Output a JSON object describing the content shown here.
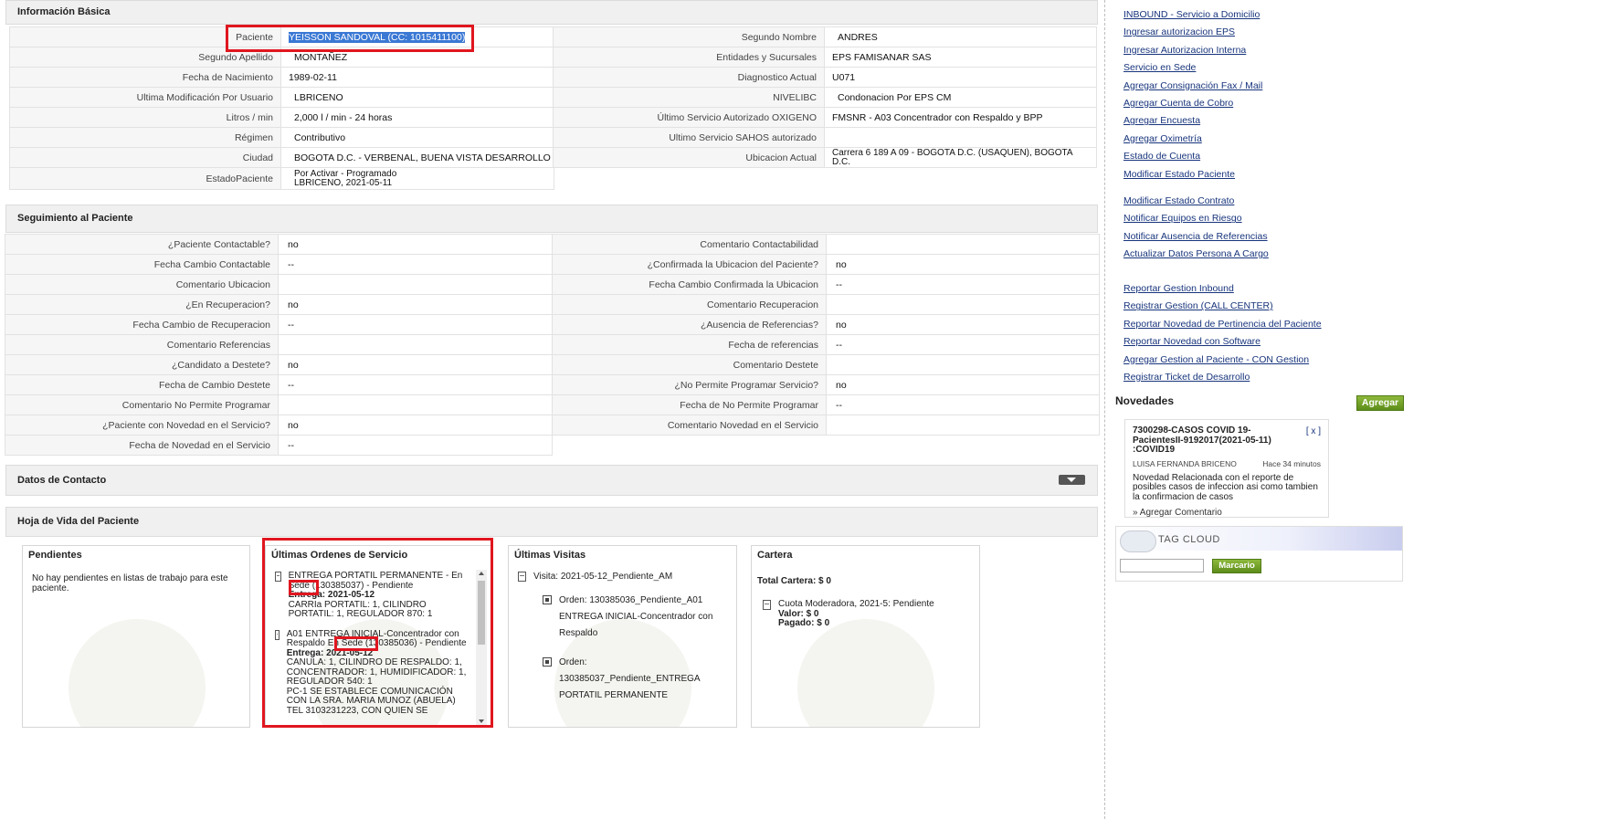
{
  "basic_info": {
    "title": "Información Básica",
    "left_rows": [
      {
        "label": "Paciente",
        "value": "YEISSON SANDOVAL (CC: 1015411100)"
      },
      {
        "label": "Segundo Apellido",
        "value": "MONTAÑEZ"
      },
      {
        "label": "Fecha de Nacimiento",
        "value": "1989-02-11"
      },
      {
        "label": "Ultima Modificación Por Usuario",
        "value": "LBRICENO"
      },
      {
        "label": "Litros / min",
        "value": "2,000 l / min - 24 horas"
      },
      {
        "label": "Régimen",
        "value": "Contributivo"
      },
      {
        "label": "Ciudad",
        "value": "BOGOTA D.C. - VERBENAL, BUENA VISTA DESARROLLO"
      },
      {
        "label": "EstadoPaciente",
        "value_line1": "Por Activar - Programado",
        "value_line2": "LBRICENO, 2021-05-11"
      }
    ],
    "right_rows": [
      {
        "label": "Segundo Nombre",
        "value": "ANDRES"
      },
      {
        "label": "Entidades y Sucursales",
        "value": "EPS FAMISANAR SAS"
      },
      {
        "label": "Diagnostico Actual",
        "value": "U071"
      },
      {
        "label": "NIVELIBC",
        "value": "Condonacion Por EPS CM"
      },
      {
        "label": "Último Servicio Autorizado OXIGENO",
        "value": "FMSNR - A03 Concentrador con Respaldo y BPP"
      },
      {
        "label": "Ultimo Servicio SAHOS autorizado",
        "value": ""
      },
      {
        "label": "Ubicacion Actual",
        "value": "Carrera 6 189 A 09 - BOGOTA D.C. (USAQUEN), BOGOTA D.C."
      }
    ]
  },
  "tracking": {
    "title": "Seguimiento al Paciente",
    "left_rows": [
      {
        "label": "¿Paciente Contactable?",
        "value": "no"
      },
      {
        "label": "Fecha Cambio Contactable",
        "value": "--"
      },
      {
        "label": "Comentario Ubicacion",
        "value": ""
      },
      {
        "label": "¿En Recuperacion?",
        "value": "no"
      },
      {
        "label": "Fecha Cambio de Recuperacion",
        "value": "--"
      },
      {
        "label": "Comentario Referencias",
        "value": ""
      },
      {
        "label": "¿Candidato a Destete?",
        "value": "no"
      },
      {
        "label": "Fecha de Cambio Destete",
        "value": "--"
      },
      {
        "label": "Comentario No Permite Programar",
        "value": ""
      },
      {
        "label": "¿Paciente con Novedad en el Servicio?",
        "value": "no"
      },
      {
        "label": "Fecha de Novedad en el Servicio",
        "value": "--"
      }
    ],
    "right_rows": [
      {
        "label": "Comentario Contactabilidad",
        "value": ""
      },
      {
        "label": "¿Confirmada la Ubicacion del Paciente?",
        "value": "no"
      },
      {
        "label": "Fecha Cambio Confirmada la Ubicacion",
        "value": "--"
      },
      {
        "label": "Comentario Recuperacion",
        "value": ""
      },
      {
        "label": "¿Ausencia de Referencias?",
        "value": "no"
      },
      {
        "label": "Fecha de referencias",
        "value": "--"
      },
      {
        "label": "Comentario Destete",
        "value": ""
      },
      {
        "label": "¿No Permite Programar Servicio?",
        "value": "no"
      },
      {
        "label": "Fecha de No Permite Programar",
        "value": "--"
      },
      {
        "label": "Comentario Novedad en el Servicio",
        "value": ""
      }
    ]
  },
  "contact": {
    "title": "Datos de Contacto"
  },
  "history": {
    "title": "Hoja de Vida del Paciente",
    "pending": {
      "title": "Pendientes",
      "text": "No hay pendientes en listas de trabajo para este paciente."
    },
    "orders": {
      "title": "Últimas Ordenes de Servicio",
      "o1_a": "ENTREGA PORTATIL PERMANENTE - En",
      "o1_sede": "Sede",
      "o1_b": "(130385037) - Pendiente",
      "o1_entrega_label": "Entrega:",
      "o1_entrega_date": "2021-05-12",
      "o1_items": "CARRIa PORTATIL: 1, CILINDRO PORTATIL: 1, REGULADOR 870: 1",
      "o2_a": "A01 ENTREGA INICIAL-Concentrador con Respaldo",
      "o2_sede": "En Sede",
      "o2_b": "(130385036) - Pendiente",
      "o2_entrega_label": "Entrega:",
      "o2_entrega_date": "2021-05-12",
      "o2_items": "CANULA: 1, CILINDRO DE RESPALDO: 1, CONCENTRADOR: 1, HUMIDIFICADOR: 1, REGULADOR 540: 1",
      "o2_note": "PC-1 SE ESTABLECE COMUNICACIÓN CON LA SRA. MARIA MUNOZ (ABUELA) TEL 3103231223, CON QUIEN SE"
    },
    "visits": {
      "title": "Últimas Visitas",
      "visit": "Visita: 2021-05-12_Pendiente_AM",
      "order1": "Orden: 130385036_Pendiente_A01 ENTREGA INICIAL-Concentrador con Respaldo",
      "order2": "Orden: 130385037_Pendiente_ENTREGA PORTATIL PERMANENTE"
    },
    "wallet": {
      "title": "Cartera",
      "total": "Total Cartera: $ 0",
      "item": "Cuota Moderadora, 2021-5: Pendiente",
      "valor": "Valor: $ 0",
      "pagado": "Pagado: $ 0"
    }
  },
  "sidebar": {
    "links_top": [
      "INBOUND - Servicio a Domicilio",
      "Ingresar autorizacion EPS",
      "Ingresar Autorizacion Interna",
      "Servicio en Sede",
      "Agregar Consignación Fax / Mail",
      "Agregar Cuenta de Cobro",
      "Agregar Encuesta",
      "Agregar Oximetría",
      "Estado de Cuenta",
      "Modificar Estado Paciente"
    ],
    "links_mid": [
      "Modificar Estado Contrato",
      "Notificar Equipos en Riesgo",
      "Notificar Ausencia de Referencias",
      "Actualizar Datos Persona A Cargo"
    ],
    "links_bottom": [
      "Reportar Gestion Inbound",
      "Registrar Gestion (CALL CENTER)",
      "Reportar Novedad de Pertinencia del Paciente",
      "Reportar Novedad con Software",
      "Agregar Gestion al Paciente - CON Gestion",
      "Registrar Ticket de Desarrollo"
    ],
    "news_title": "Novedades",
    "add_button": "Agregar",
    "news_item": {
      "title": "7300298-CASOS COVID 19-PacientesII-9192017(2021-05-11) :COVID19",
      "close": "[ x ]",
      "author": "LUISA FERNANDA BRICENO",
      "time": "Hace 34 minutos",
      "body": "Novedad Relacionada con el reporte de posibles casos de infeccion asi como tambien la confirmacion de casos",
      "comment": "» Agregar Comentario"
    },
    "tag_cloud_title": "TAG CLOUD",
    "mark_button": "Marcario"
  }
}
